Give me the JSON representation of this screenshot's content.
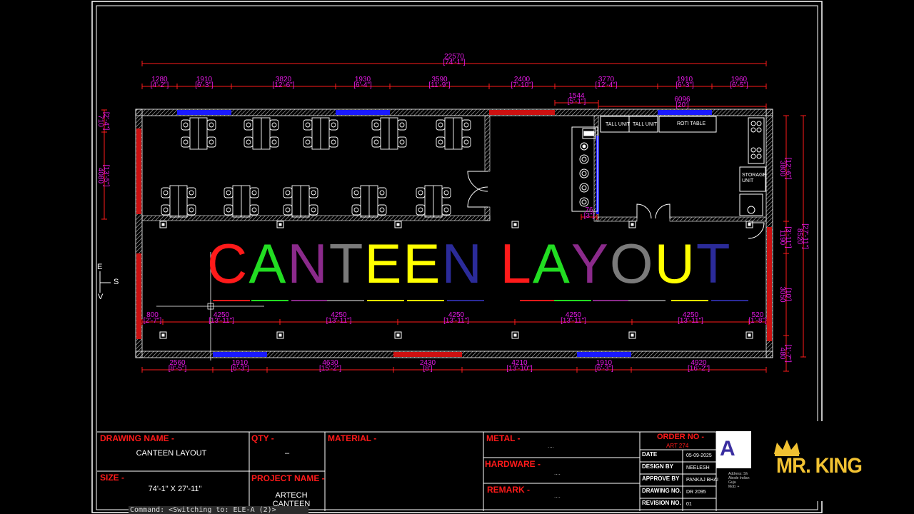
{
  "drawing": {
    "title_letters": [
      {
        "ch": "C",
        "color": "#ff1a1a"
      },
      {
        "ch": "A",
        "color": "#22dd22"
      },
      {
        "ch": "N",
        "color": "#8b2a8b"
      },
      {
        "ch": "T",
        "color": "#7a7a7a"
      },
      {
        "ch": "E",
        "color": "#ffff00"
      },
      {
        "ch": "E",
        "color": "#ffff00"
      },
      {
        "ch": "N",
        "color": "#2b2b99"
      },
      {
        "ch": " ",
        "color": "#000000"
      },
      {
        "ch": "L",
        "color": "#ff1a1a"
      },
      {
        "ch": "A",
        "color": "#22dd22"
      },
      {
        "ch": "Y",
        "color": "#8b2a8b"
      },
      {
        "ch": "O",
        "color": "#7a7a7a"
      },
      {
        "ch": "U",
        "color": "#ffff00"
      },
      {
        "ch": "T",
        "color": "#2b2b99"
      }
    ],
    "overall_dim": {
      "mm": "22570",
      "ft": "[74'-1\"]"
    },
    "top_dims": [
      {
        "mm": "1280",
        "ft": "[4'-2\"]"
      },
      {
        "mm": "1910",
        "ft": "[6'-3\"]"
      },
      {
        "mm": "3820",
        "ft": "[12'-6\"]"
      },
      {
        "mm": "1930",
        "ft": "[6'-4\"]"
      },
      {
        "mm": "3590",
        "ft": "[11'-9\"]"
      },
      {
        "mm": "2400",
        "ft": "[7'-10\"]"
      },
      {
        "mm": "3770",
        "ft": "[12'-4\"]"
      },
      {
        "mm": "1910",
        "ft": "[6'-3\"]"
      },
      {
        "mm": "1960",
        "ft": "[6'-5\"]"
      }
    ],
    "kitchen_dims": [
      {
        "mm": "1544",
        "ft": "[5'-1\"]"
      },
      {
        "mm": "6096",
        "ft": "[20']"
      }
    ],
    "mid_dims": [
      {
        "mm": "800",
        "ft": "[2'-7\"]"
      },
      {
        "mm": "4250",
        "ft": "[13'-11\"]"
      },
      {
        "mm": "4250",
        "ft": "[13'-11\"]"
      },
      {
        "mm": "4250",
        "ft": "[13'-11\"]"
      },
      {
        "mm": "4250",
        "ft": "[13'-11\"]"
      },
      {
        "mm": "4250",
        "ft": "[13'-11\"]"
      },
      {
        "mm": "520",
        "ft": "[1'-8\"]"
      }
    ],
    "bottom_dims": [
      {
        "mm": "2560",
        "ft": "[8'-5\"]"
      },
      {
        "mm": "1910",
        "ft": "[6'-3\"]"
      },
      {
        "mm": "4630",
        "ft": "[15'-2\"]"
      },
      {
        "mm": "2430",
        "ft": "[8']"
      },
      {
        "mm": "4210",
        "ft": "[13'-10\"]"
      },
      {
        "mm": "1910",
        "ft": "[6'-3\"]"
      },
      {
        "mm": "4920",
        "ft": "[16'-2\"]"
      }
    ],
    "left_dims": [
      {
        "mm": "710",
        "ft": "[2'-4\"]"
      },
      {
        "mm": "4080",
        "ft": "[13'-5\"]"
      }
    ],
    "right_dims": [
      {
        "mm": "3800",
        "ft": "[12'-6\"]"
      },
      {
        "mm": "1190",
        "ft": "[3'-11\"]"
      },
      {
        "mm": "3050",
        "ft": "[10']"
      },
      {
        "mm": "8520",
        "ft": "[27'-11\"]"
      },
      {
        "mm": "480",
        "ft": "[1'-7\"]"
      }
    ],
    "small_dim": {
      "mm": "76",
      "ft": "[3\"]"
    },
    "kitchen_labels": {
      "tall_unit_1": "TALL UNIT",
      "tall_unit_2": "TALL UNIT",
      "roti_table": "ROTI TABLE",
      "storage_unit": "STORAGE UNIT"
    },
    "compass": {
      "e": "E",
      "s": "S",
      "v": "V"
    }
  },
  "title_block": {
    "drawing_name_label": "DRAWING NAME -",
    "drawing_name": "CANTEEN LAYOUT",
    "qty_label": "QTY -",
    "qty": "–",
    "material_label": "MATERIAL -",
    "metal_label": "METAL -",
    "metal_value": "....",
    "hardware_label": "HARDWARE -",
    "hardware_value": "....",
    "remark_label": "REMARK -",
    "remark_value": "....",
    "size_label": "SIZE -",
    "size": "74'-1\" X 27'-11\"",
    "project_name_label": "PROJECT NAME -",
    "project_name_line1": "ARTECH",
    "project_name_line2": "CANTEEN",
    "order_no_label": "ORDER NO -",
    "order_no": "ART 274",
    "rows": [
      {
        "label": "DATE",
        "value": "05-09-2025"
      },
      {
        "label": "DESIGN BY",
        "value": "NEELESH"
      },
      {
        "label": "APPROVE BY",
        "value": "PANKAJ BHAI"
      },
      {
        "label": "DRAWING NO.",
        "value": "DR 2095"
      },
      {
        "label": "REVISION NO.",
        "value": "01"
      }
    ],
    "logo_letter": "A",
    "address_lines": [
      "Address: Sh",
      "Abode Indian",
      "Guja",
      "Mob: +"
    ]
  },
  "watermark": {
    "text": "MR. KING"
  },
  "command_line": {
    "text": "Command:   <Switching to: ELE-A (2)>"
  },
  "colors": {
    "dim": "#ff1a1a",
    "dim_text": "#e619e6",
    "wall": "#ffffff",
    "window_blue": "#1a1aff",
    "door_red": "#cc1111"
  }
}
